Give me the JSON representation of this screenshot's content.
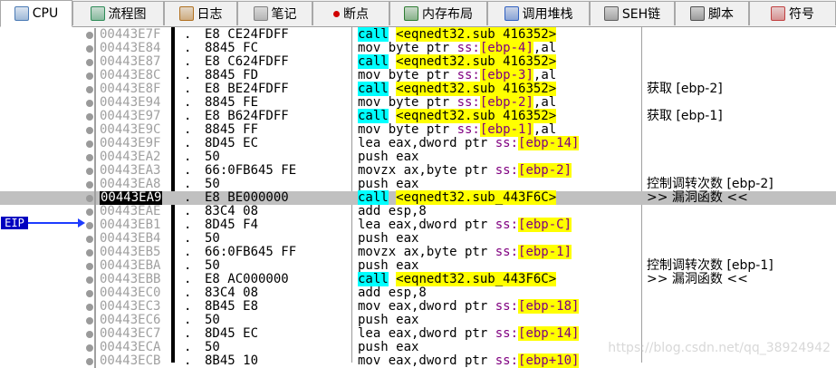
{
  "tabs": [
    {
      "label": "CPU",
      "icon": "cpu-icon",
      "active": true
    },
    {
      "label": "流程图",
      "icon": "flowchart-icon"
    },
    {
      "label": "日志",
      "icon": "log-icon"
    },
    {
      "label": "笔记",
      "icon": "notes-icon"
    },
    {
      "label": "断点",
      "icon": "breakpoint-icon"
    },
    {
      "label": "内存布局",
      "icon": "memory-map-icon"
    },
    {
      "label": "调用堆栈",
      "icon": "call-stack-icon"
    },
    {
      "label": "SEH链",
      "icon": "seh-chain-icon"
    },
    {
      "label": "脚本",
      "icon": "script-icon"
    },
    {
      "label": "符号",
      "icon": "symbols-icon"
    }
  ],
  "eip_label": "EIP",
  "selected_index": 12,
  "rows": [
    {
      "addr": "00443E7F",
      "dot": ".",
      "hex": "E8 CE24FDFF",
      "asm": "call <eqnedt32.sub_416352>",
      "type": "call",
      "target": "<eqnedt32.sub_416352>",
      "comment": ""
    },
    {
      "addr": "00443E84",
      "dot": ".",
      "hex": "8845 FC",
      "asm": "mov byte ptr ss:[ebp-4],al",
      "type": "mov",
      "pre": "mov byte ptr ",
      "ss": "ss:",
      "br": "[ebp-4]",
      "post": ",al",
      "comment": ""
    },
    {
      "addr": "00443E87",
      "dot": ".",
      "hex": "E8 C624FDFF",
      "asm": "call <eqnedt32.sub_416352>",
      "type": "call",
      "target": "<eqnedt32.sub_416352>",
      "comment": ""
    },
    {
      "addr": "00443E8C",
      "dot": ".",
      "hex": "8845 FD",
      "asm": "mov byte ptr ss:[ebp-3],al",
      "type": "mov",
      "pre": "mov byte ptr ",
      "ss": "ss:",
      "br": "[ebp-3]",
      "post": ",al",
      "comment": ""
    },
    {
      "addr": "00443E8F",
      "dot": ".",
      "hex": "E8 BE24FDFF",
      "asm": "call <eqnedt32.sub_416352>",
      "type": "call",
      "target": "<eqnedt32.sub_416352>",
      "comment": "获取 [ebp-2]"
    },
    {
      "addr": "00443E94",
      "dot": ".",
      "hex": "8845 FE",
      "asm": "mov byte ptr ss:[ebp-2],al",
      "type": "mov",
      "pre": "mov byte ptr ",
      "ss": "ss:",
      "br": "[ebp-2]",
      "post": ",al",
      "comment": ""
    },
    {
      "addr": "00443E97",
      "dot": ".",
      "hex": "E8 B624FDFF",
      "asm": "call <eqnedt32.sub_416352>",
      "type": "call",
      "target": "<eqnedt32.sub_416352>",
      "comment": "获取 [ebp-1]"
    },
    {
      "addr": "00443E9C",
      "dot": ".",
      "hex": "8845 FF",
      "asm": "mov byte ptr ss:[ebp-1],al",
      "type": "mov",
      "pre": "mov byte ptr ",
      "ss": "ss:",
      "br": "[ebp-1]",
      "post": ",al",
      "comment": ""
    },
    {
      "addr": "00443E9F",
      "dot": ".",
      "hex": "8D45 EC",
      "asm": "lea eax,dword ptr ss:[ebp-14]",
      "type": "mov",
      "pre": "lea eax,dword ptr ",
      "ss": "ss:",
      "br": "[ebp-14]",
      "post": "",
      "comment": ""
    },
    {
      "addr": "00443EA2",
      "dot": ".",
      "hex": "50",
      "asm": "push eax",
      "type": "plain",
      "comment": ""
    },
    {
      "addr": "00443EA3",
      "dot": ".",
      "hex": "66:0FB645 FE",
      "asm": "movzx ax,byte ptr ss:[ebp-2]",
      "type": "mov",
      "pre": "movzx ax,byte ptr ",
      "ss": "ss:",
      "br": "[ebp-2]",
      "post": "",
      "comment": ""
    },
    {
      "addr": "00443EA8",
      "dot": ".",
      "hex": "50",
      "asm": "push eax",
      "type": "plain",
      "comment": "控制调转次数 [ebp-2]"
    },
    {
      "addr": "00443EA9",
      "dot": ".",
      "hex": "E8 BE000000",
      "asm": "call <eqnedt32.sub_443F6C>",
      "type": "call",
      "target": "<eqnedt32.sub_443F6C>",
      "comment": ">> 漏洞函数 <<"
    },
    {
      "addr": "00443EAE",
      "dot": ".",
      "hex": "83C4 08",
      "asm": "add esp,8",
      "type": "plain",
      "comment": ""
    },
    {
      "addr": "00443EB1",
      "dot": ".",
      "hex": "8D45 F4",
      "asm": "lea eax,dword ptr ss:[ebp-C]",
      "type": "mov",
      "pre": "lea eax,dword ptr ",
      "ss": "ss:",
      "br": "[ebp-C]",
      "post": "",
      "comment": ""
    },
    {
      "addr": "00443EB4",
      "dot": ".",
      "hex": "50",
      "asm": "push eax",
      "type": "plain",
      "comment": ""
    },
    {
      "addr": "00443EB5",
      "dot": ".",
      "hex": "66:0FB645 FF",
      "asm": "movzx ax,byte ptr ss:[ebp-1]",
      "type": "mov",
      "pre": "movzx ax,byte ptr ",
      "ss": "ss:",
      "br": "[ebp-1]",
      "post": "",
      "comment": ""
    },
    {
      "addr": "00443EBA",
      "dot": ".",
      "hex": "50",
      "asm": "push eax",
      "type": "plain",
      "comment": "控制调转次数 [ebp-1]"
    },
    {
      "addr": "00443EBB",
      "dot": ".",
      "hex": "E8 AC000000",
      "asm": "call <eqnedt32.sub_443F6C>",
      "type": "call",
      "target": "<eqnedt32.sub_443F6C>",
      "comment": ">> 漏洞函数 <<"
    },
    {
      "addr": "00443EC0",
      "dot": ".",
      "hex": "83C4 08",
      "asm": "add esp,8",
      "type": "plain",
      "comment": ""
    },
    {
      "addr": "00443EC3",
      "dot": ".",
      "hex": "8B45 E8",
      "asm": "mov eax,dword ptr ss:[ebp-18]",
      "type": "mov",
      "pre": "mov eax,dword ptr ",
      "ss": "ss:",
      "br": "[ebp-18]",
      "post": "",
      "comment": ""
    },
    {
      "addr": "00443EC6",
      "dot": ".",
      "hex": "50",
      "asm": "push eax",
      "type": "plain",
      "comment": ""
    },
    {
      "addr": "00443EC7",
      "dot": ".",
      "hex": "8D45 EC",
      "asm": "lea eax,dword ptr ss:[ebp-14]",
      "type": "mov",
      "pre": "lea eax,dword ptr ",
      "ss": "ss:",
      "br": "[ebp-14]",
      "post": "",
      "comment": ""
    },
    {
      "addr": "00443ECA",
      "dot": ".",
      "hex": "50",
      "asm": "push eax",
      "type": "plain",
      "comment": ""
    },
    {
      "addr": "00443ECB",
      "dot": ".",
      "hex": "8B45 10",
      "asm": "mov eax,dword ptr ss:[ebp+10]",
      "type": "mov",
      "pre": "mov eax,dword ptr ",
      "ss": "ss:",
      "br": "[ebp+10]",
      "post": "",
      "comment": ""
    }
  ],
  "watermark": "https://blog.csdn.net/qq_38924942"
}
